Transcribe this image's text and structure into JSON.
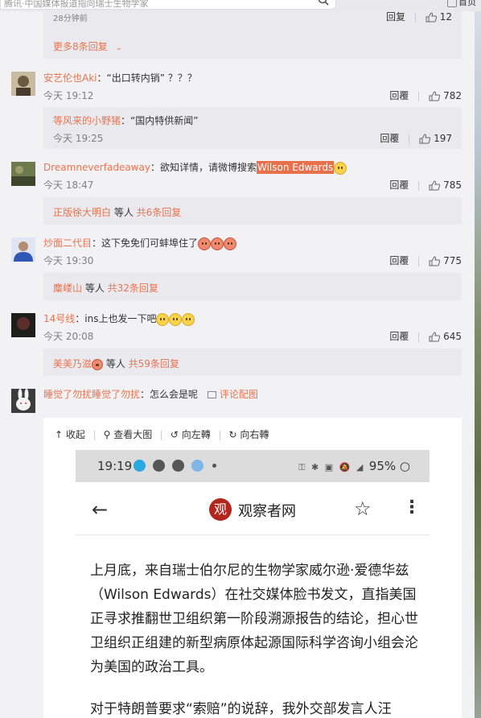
{
  "topbar": {
    "search_placeholder": "腾讯·中国媒体报道指向瑞士生物学家",
    "right_text": "首页"
  },
  "top_reply": {
    "time": "28分钟前",
    "reply": "回复",
    "likes": "12"
  },
  "more_replies": "更多8条回复",
  "comments": [
    {
      "user": "安艺伦也Aki",
      "text": "：“出口转内销” ？？？",
      "time": "今天 19:12",
      "reply": "回覆",
      "likes": "782",
      "avatar_color": "#8a7a5a",
      "sub": {
        "user": "等风来的小野猪",
        "text": "：“国内特供新闻”",
        "time": "今天 19:25",
        "reply": "回覆",
        "likes": "197"
      }
    },
    {
      "user": "Dreamneverfadeaway",
      "text_before": "：欲知详情，请微博搜索",
      "highlight": "Wilson Edwards",
      "time": "今天 18:47",
      "reply": "回覆",
      "likes": "785",
      "avatar_color": "#4f5a3a",
      "sub_summary": {
        "user": "正版徐大明白",
        "mid": " 等人 ",
        "count": "共6条回复"
      }
    },
    {
      "user": "炒面二代目",
      "text": "：这下免免们可蚌埠住了",
      "time": "今天 19:30",
      "reply": "回覆",
      "likes": "775",
      "avatar_color": "#3d5aa6",
      "sub_summary": {
        "user": "麋嵝山",
        "mid": " 等人 ",
        "count": "共32条回复"
      }
    },
    {
      "user": "14号线",
      "text": "：ins上也发一下吧",
      "time": "今天 20:08",
      "reply": "回覆",
      "likes": "645",
      "avatar_color": "#2a2a24",
      "sub_summary": {
        "user": "美美乃滋",
        "mid": " 等人 ",
        "count": "共59条回复"
      }
    },
    {
      "user": "睡觉了勿扰睡觉了勿扰",
      "text": "：怎么会是呢",
      "pic_link": "评论配图",
      "avatar_color": "#e8e8e8"
    }
  ],
  "viewer": {
    "tools": [
      "收起",
      "查看大图",
      "向左轉",
      "向右轉"
    ]
  },
  "phone": {
    "status_time": "19:19",
    "status_right": "95%",
    "app_name": "观察者网",
    "logo_char": "观",
    "paragraphs": [
      "上月底，来自瑞士伯尔尼的生物学家威尔逊·爱德华兹（Wilson Edwards）在社交媒体脸书发文，直指美国正寻求推翻世卫组织第一阶段溯源报告的结论，担心世卫组织正组建的新型病原体起源国际科学咨询小组会沦为美国的政治工具。",
      "对于特朗普要求“索赔”的说辞，我外交部发言人汪"
    ]
  }
}
